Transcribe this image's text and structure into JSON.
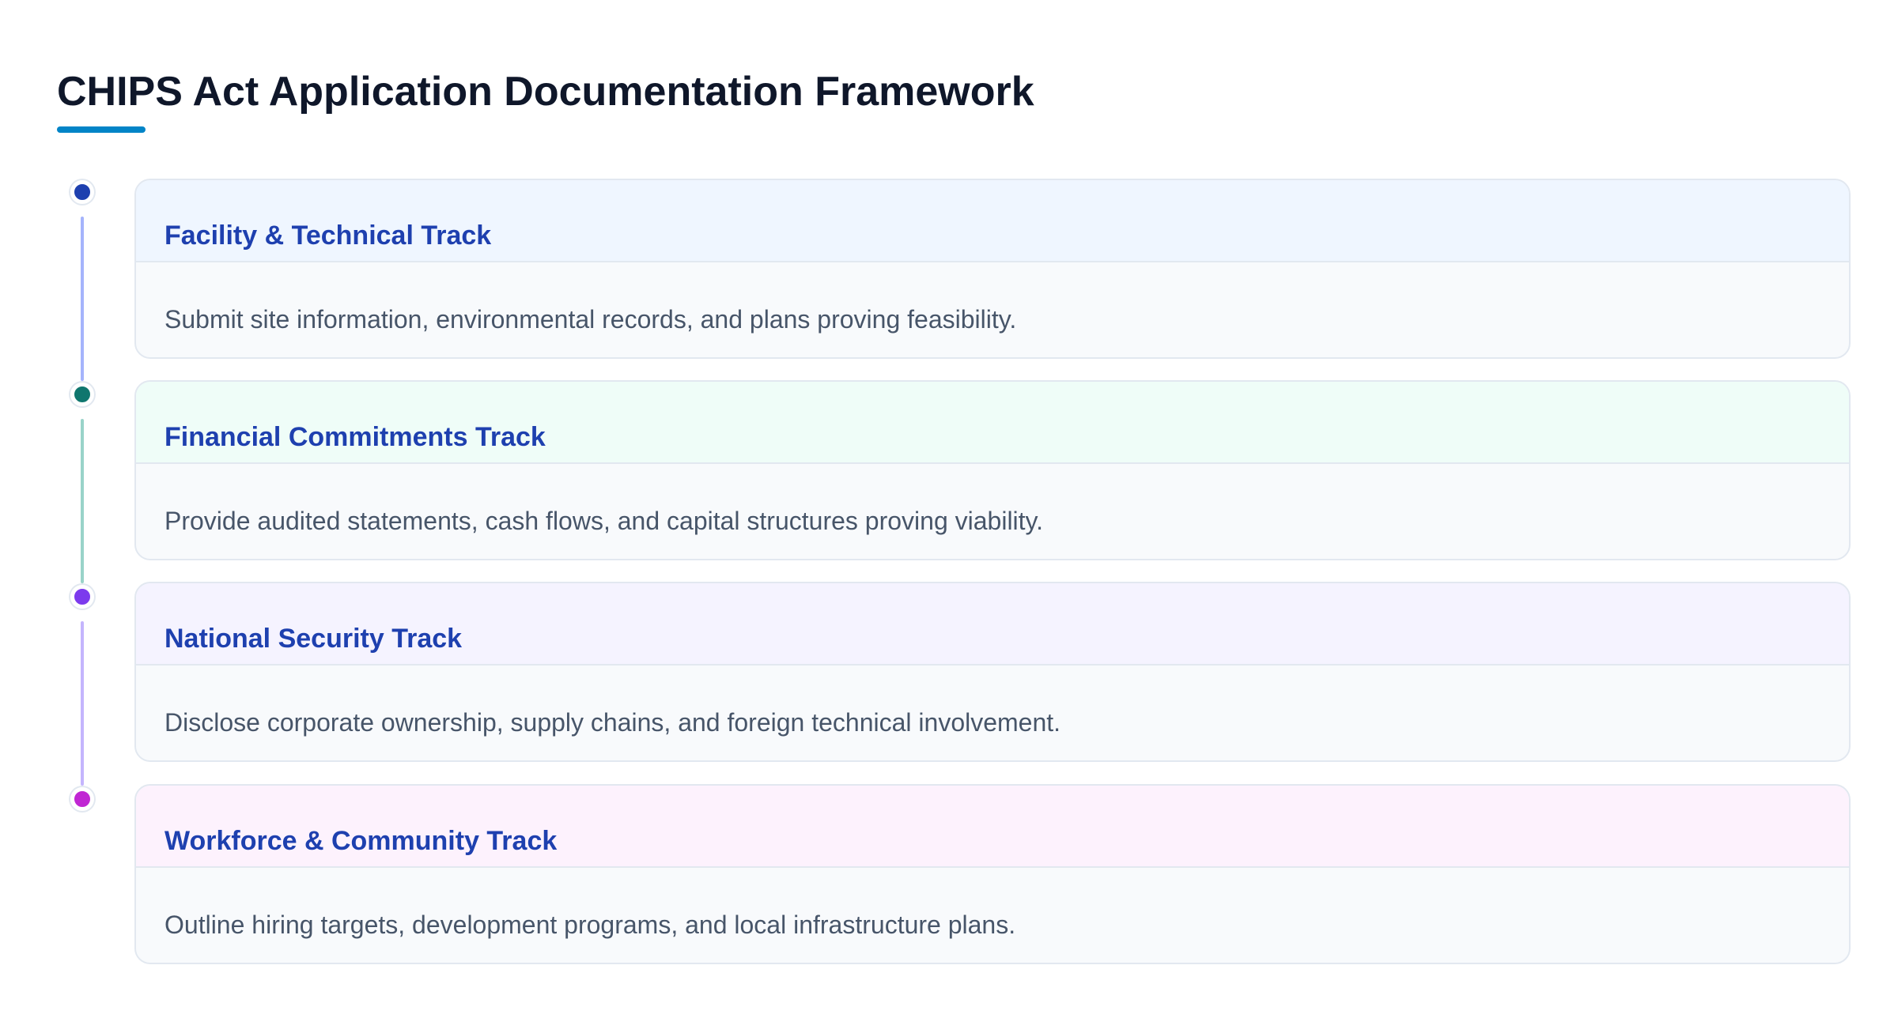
{
  "title": "CHIPS Act Application Documentation Framework",
  "colors": {
    "title_text": "#0f172a",
    "accent_underline": "#0284c7",
    "track_title_text": "#1e40af",
    "description_text": "#475569"
  },
  "tracks": [
    {
      "title": "Facility & Technical Track",
      "description": "Submit site information, environmental records, and plans proving feasibility.",
      "dot_color": "#1e40af",
      "line_color": "#a5b4fc",
      "header_bg": "#eff6ff"
    },
    {
      "title": "Financial Commitments Track",
      "description": "Provide audited statements, cash flows, and capital structures proving viability.",
      "dot_color": "#0f766e",
      "line_color": "#99d3c9",
      "header_bg": "#effdf8"
    },
    {
      "title": "National Security Track",
      "description": "Disclose corporate ownership, supply chains, and foreign technical involvement.",
      "dot_color": "#7c3aed",
      "line_color": "#c4b5fd",
      "header_bg": "#f5f3ff"
    },
    {
      "title": "Workforce & Community Track",
      "description": "Outline hiring targets, development programs, and local infrastructure plans.",
      "dot_color": "#c026d3",
      "line_color": "#f0abfc",
      "header_bg": "#fdf2fd"
    }
  ]
}
